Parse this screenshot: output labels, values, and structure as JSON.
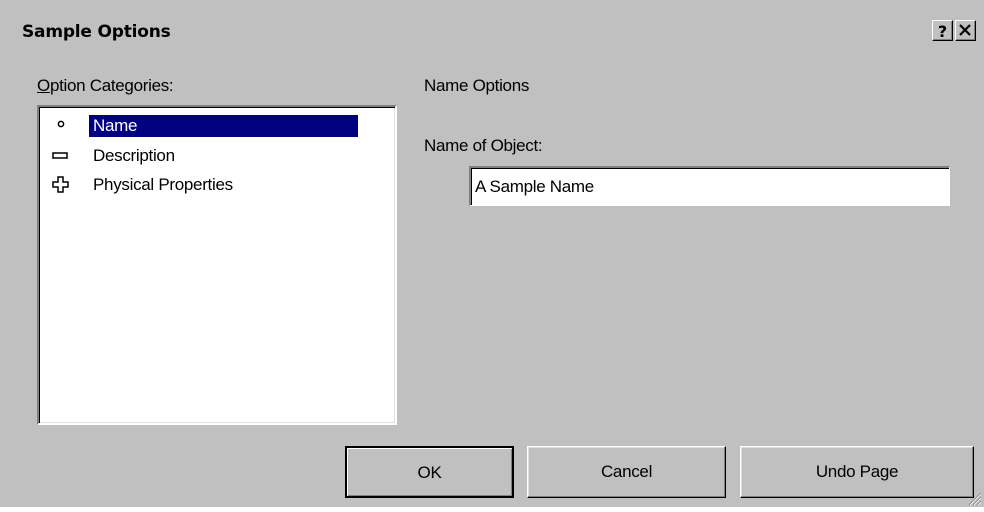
{
  "window": {
    "title": "Sample Options",
    "help_button": "?",
    "close_button": "×"
  },
  "categories": {
    "label": "Option Categories:",
    "items": [
      {
        "label": "Name",
        "icon": "bullet-icon",
        "selected": true
      },
      {
        "label": "Description",
        "icon": "minus-box-icon",
        "selected": false
      },
      {
        "label": "Physical Properties",
        "icon": "plus-box-icon",
        "selected": false
      }
    ]
  },
  "panel": {
    "heading": "Name Options",
    "name_label": "Name of Object:",
    "name_value": "A Sample Name"
  },
  "buttons": {
    "ok": "OK",
    "cancel": "Cancel",
    "undo": "Undo Page"
  },
  "colors": {
    "face": "#c0c0c0",
    "selection": "#000080"
  }
}
